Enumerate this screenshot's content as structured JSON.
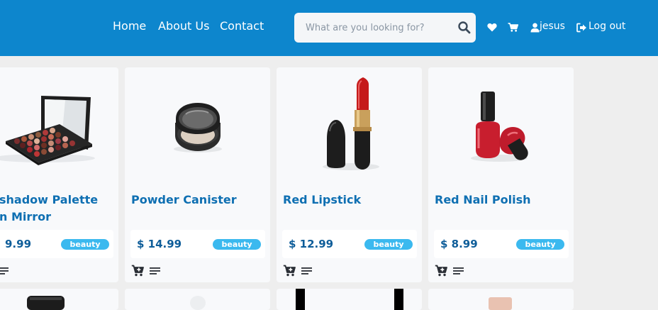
{
  "nav": {
    "links": [
      "Home",
      "About Us",
      "Contact"
    ],
    "search_placeholder": "What are you looking for?",
    "username": "jesus",
    "logout_label": "Log out"
  },
  "products": [
    {
      "title": "shadow Palette\nn Mirror",
      "price": "9.99",
      "category": "beauty"
    },
    {
      "title": "Powder Canister",
      "price": "$ 14.99",
      "category": "beauty"
    },
    {
      "title": "Red Lipstick",
      "price": "$ 12.99",
      "category": "beauty"
    },
    {
      "title": "Red Nail Polish",
      "price": "$ 8.99",
      "category": "beauty"
    }
  ],
  "colors": {
    "navbar": "#0d86cd",
    "title": "#0e6fb2",
    "badge": "#3bb9ef",
    "price": "#0e5d99"
  }
}
